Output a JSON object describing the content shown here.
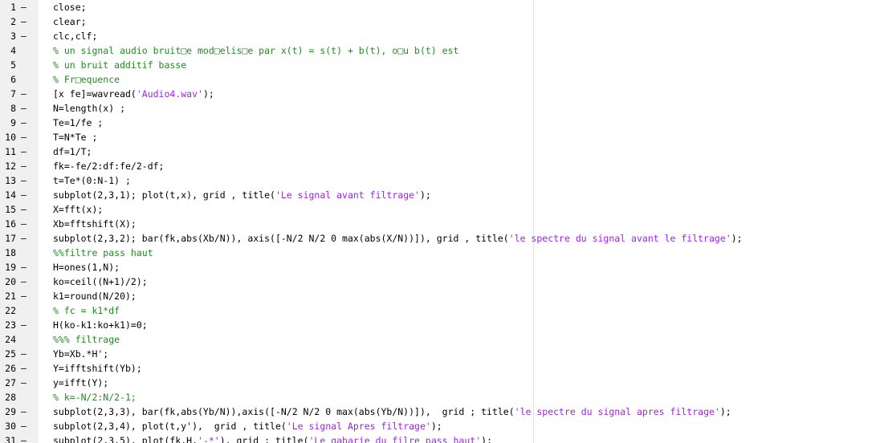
{
  "colors": {
    "text": "#000000",
    "string": "#a020f0",
    "comment": "#228b22",
    "gutter_bg": "#f0f0f0"
  },
  "editor": {
    "lines": [
      {
        "n": "1",
        "mark": "–",
        "segs": [
          {
            "t": "close;",
            "k": "text"
          }
        ]
      },
      {
        "n": "2",
        "mark": "–",
        "segs": [
          {
            "t": "clear;",
            "k": "text"
          }
        ]
      },
      {
        "n": "3",
        "mark": "–",
        "segs": [
          {
            "t": "clc,clf;",
            "k": "text"
          }
        ]
      },
      {
        "n": "4",
        "mark": "",
        "segs": [
          {
            "t": "% un signal audio bruit□e mod□elis□e par x(t) = s(t) + b(t), o□u b(t) est",
            "k": "comment"
          }
        ]
      },
      {
        "n": "5",
        "mark": "",
        "segs": [
          {
            "t": "% un bruit additif basse",
            "k": "comment"
          }
        ]
      },
      {
        "n": "6",
        "mark": "",
        "segs": [
          {
            "t": "% Fr□equence",
            "k": "comment"
          }
        ]
      },
      {
        "n": "7",
        "mark": "–",
        "segs": [
          {
            "t": "[x fe]=wavread(",
            "k": "text"
          },
          {
            "t": "'Audio4.wav'",
            "k": "string"
          },
          {
            "t": ");",
            "k": "text"
          }
        ]
      },
      {
        "n": "8",
        "mark": "–",
        "segs": [
          {
            "t": "N=length(x) ;",
            "k": "text"
          }
        ]
      },
      {
        "n": "9",
        "mark": "–",
        "segs": [
          {
            "t": "Te=1/fe ;",
            "k": "text"
          }
        ]
      },
      {
        "n": "10",
        "mark": "–",
        "segs": [
          {
            "t": "T=N*Te ;",
            "k": "text"
          }
        ]
      },
      {
        "n": "11",
        "mark": "–",
        "segs": [
          {
            "t": "df=1/T;",
            "k": "text"
          }
        ]
      },
      {
        "n": "12",
        "mark": "–",
        "segs": [
          {
            "t": "fk=-fe/2:df:fe/2-df;",
            "k": "text"
          }
        ]
      },
      {
        "n": "13",
        "mark": "–",
        "segs": [
          {
            "t": "t=Te*(0:N-1) ;",
            "k": "text"
          }
        ]
      },
      {
        "n": "14",
        "mark": "–",
        "segs": [
          {
            "t": "subplot(2,3,1); plot(t,x), grid , title(",
            "k": "text"
          },
          {
            "t": "'Le signal avant filtrage'",
            "k": "string"
          },
          {
            "t": ");",
            "k": "text"
          }
        ]
      },
      {
        "n": "15",
        "mark": "–",
        "segs": [
          {
            "t": "X=fft(x);",
            "k": "text"
          }
        ]
      },
      {
        "n": "16",
        "mark": "–",
        "segs": [
          {
            "t": "Xb=fftshift(X);",
            "k": "text"
          }
        ]
      },
      {
        "n": "17",
        "mark": "–",
        "segs": [
          {
            "t": "subplot(2,3,2); bar(fk,abs(Xb/N)), axis([-N/2 N/2 0 max(abs(X/N))]), grid , title(",
            "k": "text"
          },
          {
            "t": "'le spectre du signal avant le filtrage'",
            "k": "string"
          },
          {
            "t": ");",
            "k": "text"
          }
        ]
      },
      {
        "n": "18",
        "mark": "",
        "segs": [
          {
            "t": "%%filtre pass haut",
            "k": "comment"
          }
        ]
      },
      {
        "n": "19",
        "mark": "–",
        "segs": [
          {
            "t": "H=ones(1,N);",
            "k": "text"
          }
        ]
      },
      {
        "n": "20",
        "mark": "–",
        "segs": [
          {
            "t": "ko=ceil((N+1)/2);",
            "k": "text"
          }
        ]
      },
      {
        "n": "21",
        "mark": "–",
        "segs": [
          {
            "t": "k1=round(N/20);",
            "k": "text"
          }
        ]
      },
      {
        "n": "22",
        "mark": "",
        "segs": [
          {
            "t": "% fc = k1*df",
            "k": "comment"
          }
        ]
      },
      {
        "n": "23",
        "mark": "–",
        "segs": [
          {
            "t": "H(ko-k1:ko+k1)=0;",
            "k": "text"
          }
        ]
      },
      {
        "n": "24",
        "mark": "",
        "segs": [
          {
            "t": "%%% filtrage",
            "k": "comment"
          }
        ]
      },
      {
        "n": "25",
        "mark": "–",
        "segs": [
          {
            "t": "Yb=Xb.*H';",
            "k": "text"
          }
        ]
      },
      {
        "n": "26",
        "mark": "–",
        "segs": [
          {
            "t": "Y=ifftshift(Yb);",
            "k": "text"
          }
        ]
      },
      {
        "n": "27",
        "mark": "–",
        "segs": [
          {
            "t": "y=ifft(Y);",
            "k": "text"
          }
        ]
      },
      {
        "n": "28",
        "mark": "",
        "segs": [
          {
            "t": "% k=-N/2:N/2-1;",
            "k": "comment"
          }
        ]
      },
      {
        "n": "29",
        "mark": "–",
        "segs": [
          {
            "t": "subplot(2,3,3), bar(fk,abs(Yb/N)),axis([-N/2 N/2 0 max(abs(Yb/N))]),  grid ; title(",
            "k": "text"
          },
          {
            "t": "'le spectre du signal apres filtrage'",
            "k": "string"
          },
          {
            "t": ");",
            "k": "text"
          }
        ]
      },
      {
        "n": "30",
        "mark": "–",
        "segs": [
          {
            "t": "subplot(2,3,4), plot(t,y'),  grid , title(",
            "k": "text"
          },
          {
            "t": "'Le signal Apres filtrage'",
            "k": "string"
          },
          {
            "t": ");",
            "k": "text"
          }
        ]
      },
      {
        "n": "31",
        "mark": "–",
        "segs": [
          {
            "t": "subplot(2,3,5), plot(fk,H,",
            "k": "text"
          },
          {
            "t": "'-*'",
            "k": "string"
          },
          {
            "t": "), grid ; title(",
            "k": "text"
          },
          {
            "t": "'Le gabarie du filre pass haut'",
            "k": "string"
          },
          {
            "t": ");",
            "k": "text"
          }
        ]
      }
    ]
  }
}
